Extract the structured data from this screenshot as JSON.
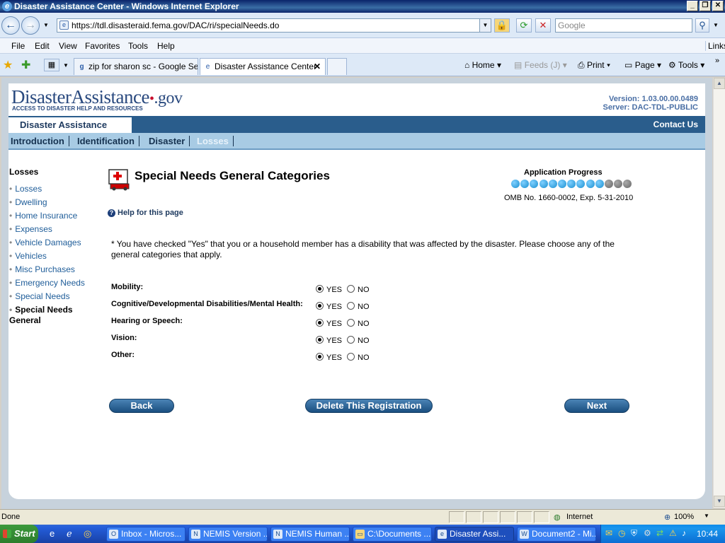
{
  "window": {
    "title": "Disaster Assistance Center - Windows Internet Explorer"
  },
  "browser": {
    "url": "https://tdl.disasteraid.fema.gov/DAC/ri/specialNeeds.do",
    "search_placeholder": "Google",
    "menu": [
      "File",
      "Edit",
      "View",
      "Favorites",
      "Tools",
      "Help"
    ],
    "links_label": "Links",
    "tabs": [
      {
        "label": "zip for sharon sc - Google Se..."
      },
      {
        "label": "Disaster Assistance Center"
      }
    ],
    "commands": {
      "home": "Home",
      "feeds": "Feeds (J)",
      "print": "Print",
      "page": "Page",
      "tools": "Tools"
    }
  },
  "site": {
    "logo_main": "DisasterAssistance",
    "logo_gov": ".gov",
    "logo_tag": "ACCESS TO DISASTER HELP AND RESOURCES",
    "version": "Version: 1.03.00.00.0489",
    "server": "Server: DAC-TDL-PUBLIC",
    "section_label": "Disaster Assistance",
    "contact": "Contact Us",
    "nav": [
      "Introduction",
      "Identification",
      "Disaster",
      "Losses"
    ]
  },
  "sidebar": {
    "heading": "Losses",
    "items": [
      "Losses",
      "Dwelling",
      "Home Insurance",
      "Expenses",
      "Vehicle Damages",
      "Vehicles",
      "Misc Purchases",
      "Emergency Needs",
      "Special Needs"
    ],
    "current": "Special Needs General"
  },
  "main": {
    "title": "Special Needs General Categories",
    "progress_label": "Application Progress",
    "progress_steps_done": 10,
    "progress_steps_total": 13,
    "omb": "OMB No. 1660-0002, Exp. 5-31-2010",
    "help": "Help for this page",
    "intro": "* You have checked \"Yes\" that you or a household member has a disability that was affected by the disaster. Please choose any of the general categories that apply.",
    "yes_label": "YES",
    "no_label": "NO",
    "questions": [
      {
        "label": "Mobility:",
        "value": "YES"
      },
      {
        "label": "Cognitive/Developmental Disabilities/Mental Health:",
        "value": "YES"
      },
      {
        "label": "Hearing or Speech:",
        "value": "YES"
      },
      {
        "label": "Vision:",
        "value": "YES"
      },
      {
        "label": "Other:",
        "value": "YES"
      }
    ],
    "buttons": {
      "back": "Back",
      "delete": "Delete This Registration",
      "next": "Next"
    }
  },
  "statusbar": {
    "text": "Done",
    "zone": "Internet",
    "zoom": "100%"
  },
  "taskbar": {
    "start": "Start",
    "items": [
      "Inbox - Micros...",
      "NEMIS Version ...",
      "NEMIS Human ...",
      "C:\\Documents ...",
      "Disaster Assi...",
      "Document2 - Mi..."
    ],
    "clock": "10:44"
  },
  "colors": {
    "brand_blue": "#2a5d8c",
    "nav_light": "#a8cbe4",
    "link": "#1f5d99",
    "progress_done": "#1a8fd0",
    "progress_todo": "#666666"
  }
}
